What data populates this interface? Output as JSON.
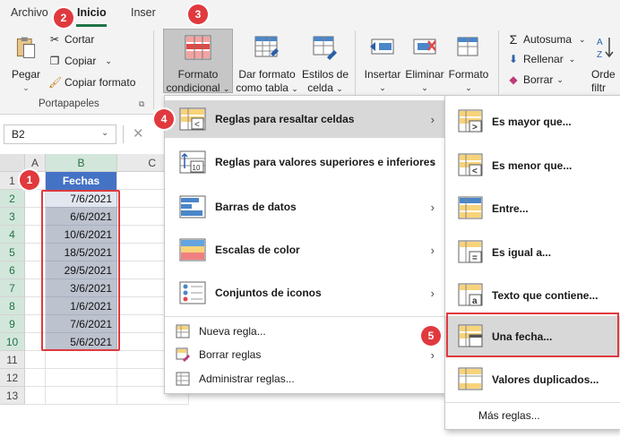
{
  "ribbon": {
    "tabs": [
      "Archivo",
      "Inicio",
      "Inser"
    ],
    "clipboard": {
      "pegar": "Pegar",
      "cortar": "Cortar",
      "copiar": "Copiar",
      "copiar_formato": "Copiar formato",
      "group_label": "Portapapeles"
    },
    "styles": {
      "formato_condicional_1": "Formato",
      "formato_condicional_2": "condicional",
      "dar_formato_1": "Dar formato",
      "dar_formato_2": "como tabla",
      "estilos_1": "Estilos de",
      "estilos_2": "celda"
    },
    "cells": {
      "insertar": "Insertar",
      "eliminar": "Eliminar",
      "formato": "Formato"
    },
    "editing": {
      "autosuma": "Autosuma",
      "rellenar": "Rellenar",
      "borrar": "Borrar",
      "orde_1": "Orde",
      "orde_2": "filtr"
    }
  },
  "formula_bar": {
    "name_box": "B2"
  },
  "sheet": {
    "columns": [
      "A",
      "B",
      "C"
    ],
    "rows": [
      "1",
      "2",
      "3",
      "4",
      "5",
      "6",
      "7",
      "8",
      "9",
      "10",
      "11",
      "12",
      "13"
    ],
    "header": "Fechas",
    "dates": [
      "7/6/2021",
      "6/6/2021",
      "10/6/2021",
      "18/5/2021",
      "29/5/2021",
      "3/6/2021",
      "1/6/2021",
      "7/6/2021",
      "5/6/2021"
    ]
  },
  "menu_cf": {
    "items": [
      "Reglas para resaltar celdas",
      "Reglas para valores superiores e inferiores",
      "Barras de datos",
      "Escalas de color",
      "Conjuntos de iconos"
    ],
    "small_items": [
      "Nueva regla...",
      "Borrar reglas",
      "Administrar reglas..."
    ]
  },
  "submenu": {
    "items": [
      "Es mayor que...",
      "Es menor que...",
      "Entre...",
      "Es igual a...",
      "Texto que contiene...",
      "Una fecha...",
      "Valores duplicados..."
    ],
    "more": "Más reglas..."
  },
  "badges": [
    "1",
    "2",
    "3",
    "4",
    "5"
  ],
  "colors": {
    "accent": "#217346",
    "header_fill": "#4472c4",
    "badge": "#e0393e"
  }
}
